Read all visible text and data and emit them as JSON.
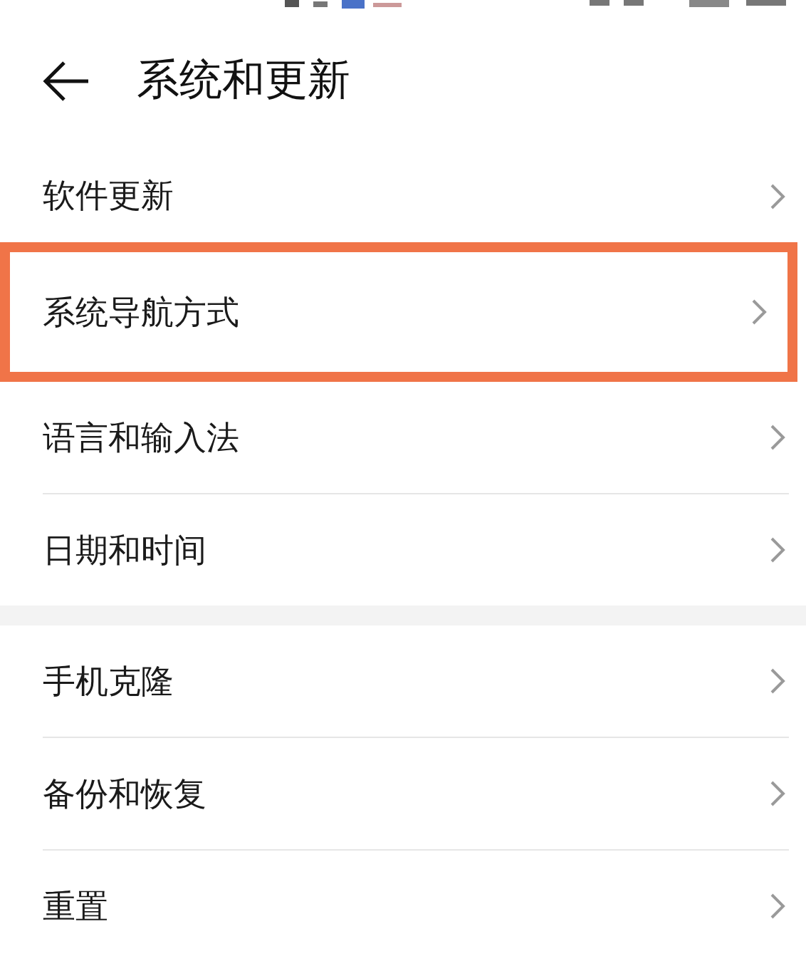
{
  "header": {
    "title": "系统和更新"
  },
  "groups": [
    {
      "items": [
        {
          "label": "软件更新",
          "highlighted": false
        },
        {
          "label": "系统导航方式",
          "highlighted": true
        },
        {
          "label": "语言和输入法",
          "highlighted": false
        },
        {
          "label": "日期和时间",
          "highlighted": false
        }
      ]
    },
    {
      "items": [
        {
          "label": "手机克隆",
          "highlighted": false
        },
        {
          "label": "备份和恢复",
          "highlighted": false
        },
        {
          "label": "重置",
          "highlighted": false
        }
      ]
    }
  ]
}
